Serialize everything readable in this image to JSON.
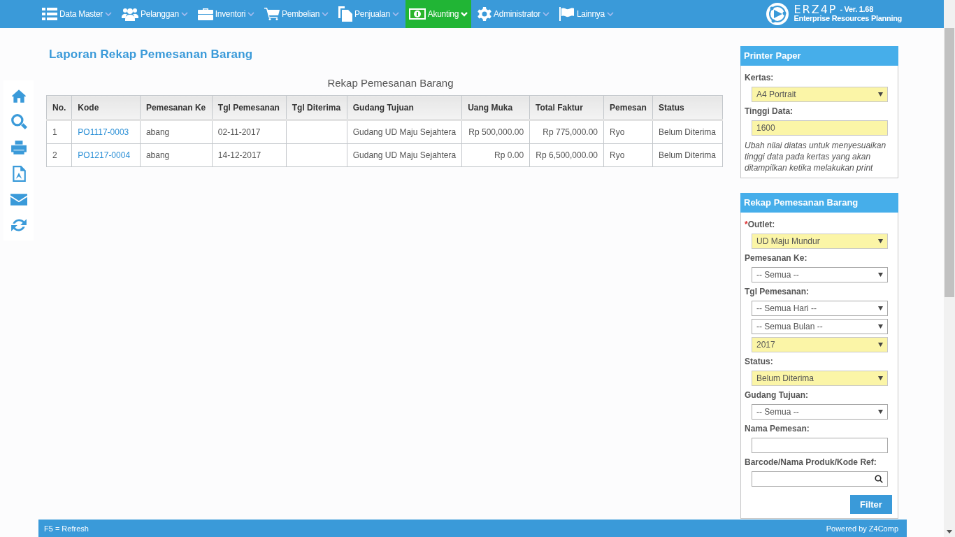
{
  "menu": {
    "items": [
      {
        "label": "Data Master",
        "selected": false
      },
      {
        "label": "Pelanggan",
        "selected": false
      },
      {
        "label": "Inventori",
        "selected": false
      },
      {
        "label": "Pembelian",
        "selected": false
      },
      {
        "label": "Penjualan",
        "selected": false
      },
      {
        "label": "Akunting",
        "selected": true
      },
      {
        "label": "Administrator",
        "selected": false
      },
      {
        "label": "Lainnya",
        "selected": false
      }
    ],
    "logo": {
      "name": "ERZ4P",
      "version": "- Ver. 1.68",
      "tagline": "Enterprise Resources Planning"
    }
  },
  "page_title": "Laporan Rekap Pemesanan Barang",
  "table": {
    "caption": "Rekap Pemesanan Barang",
    "columns": [
      {
        "label": "No.",
        "kind": "text"
      },
      {
        "label": "Kode",
        "kind": "link"
      },
      {
        "label": "Pemesanan Ke",
        "kind": "text"
      },
      {
        "label": "Tgl Pemesanan",
        "kind": "text"
      },
      {
        "label": "Tgl Diterima",
        "kind": "text"
      },
      {
        "label": "Gudang Tujuan",
        "kind": "text"
      },
      {
        "label": "Uang Muka",
        "kind": "money"
      },
      {
        "label": "Total Faktur",
        "kind": "money"
      },
      {
        "label": "Pemesan",
        "kind": "text"
      },
      {
        "label": "Status",
        "kind": "text"
      }
    ],
    "rows": [
      [
        "1",
        "PO1117-0003",
        "abang",
        "02-11-2017",
        "",
        "Gudang UD Maju Sejahtera",
        "Rp 500,000.00",
        "Rp 775,000.00",
        "Ryo",
        "Belum Diterima"
      ],
      [
        "2",
        "PO1217-0004",
        "abang",
        "14-12-2017",
        "",
        "Gudang UD Maju Sejahtera",
        "Rp 0.00",
        "Rp 6,500,000.00",
        "Ryo",
        "Belum Diterima"
      ]
    ]
  },
  "panels": [
    {
      "title": "Printer Paper",
      "fields": [
        {
          "label": "Kertas:",
          "controls": [
            {
              "kind": "select",
              "value": "A4 Portrait",
              "highlighted": true
            }
          ]
        },
        {
          "label": "Tinggi Data:",
          "controls": [
            {
              "kind": "text",
              "value": "1600",
              "highlighted": true
            }
          ]
        }
      ],
      "hint": "Ubah nilai diatas untuk menyesuaikan tinggi data pada kertas yang akan ditampilkan ketika melakukan print"
    },
    {
      "title": "Rekap Pemesanan Barang",
      "fields": [
        {
          "marker": "*",
          "label": "Outlet:",
          "controls": [
            {
              "kind": "select",
              "value": "UD Maju Mundur",
              "highlighted": true
            }
          ]
        },
        {
          "label": "Pemesanan Ke:",
          "controls": [
            {
              "kind": "select",
              "value": "-- Semua --",
              "highlighted": false
            }
          ]
        },
        {
          "label": "Tgl Pemesanan:",
          "controls": [
            {
              "kind": "select",
              "value": "-- Semua Hari --",
              "highlighted": false
            },
            {
              "kind": "select",
              "value": "-- Semua Bulan --",
              "highlighted": false
            },
            {
              "kind": "select",
              "value": "2017",
              "highlighted": true
            }
          ]
        },
        {
          "label": "Status:",
          "controls": [
            {
              "kind": "select",
              "value": "Belum Diterima",
              "highlighted": true
            }
          ]
        },
        {
          "label": "Gudang Tujuan:",
          "controls": [
            {
              "kind": "select",
              "value": "-- Semua --",
              "highlighted": false
            }
          ]
        },
        {
          "label": "Nama Pemesan:",
          "controls": [
            {
              "kind": "text",
              "highlighted": false
            }
          ]
        },
        {
          "label": "Barcode/Nama Produk/Kode Ref:",
          "controls": [
            {
              "kind": "search",
              "highlighted": false
            }
          ]
        }
      ],
      "button": "Filter"
    }
  ],
  "footer": {
    "left": "F5 = Refresh",
    "right": "Powered by Z4Comp"
  }
}
